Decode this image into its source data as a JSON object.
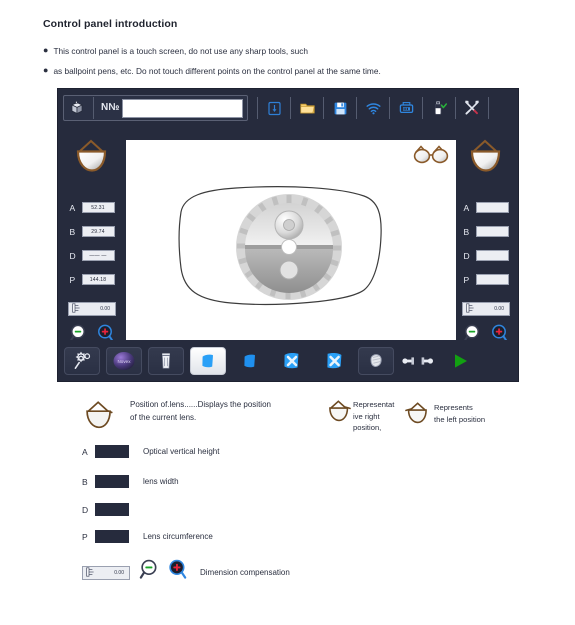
{
  "document": {
    "title": "Control panel introduction",
    "bullets": [
      "This control panel is a touch screen, do not use any sharp tools, such",
      "as ballpoint pens, etc. Do not touch different points on the control panel at the same time."
    ]
  },
  "panel": {
    "top_toolbar": {
      "job_icon": "box-icon",
      "number_label": "N№",
      "number_value": "",
      "number_placeholder": "",
      "buttons": [
        {
          "name": "download-icon",
          "label": ""
        },
        {
          "name": "open-folder-icon",
          "label": ""
        },
        {
          "name": "save-disk-icon",
          "label": ""
        },
        {
          "name": "wifi-icon",
          "label": ""
        },
        {
          "name": "printer-icon",
          "label": ""
        },
        {
          "name": "calibration-bottle-icon",
          "label": ""
        },
        {
          "name": "tools-icon",
          "label": ""
        }
      ]
    },
    "left_side": {
      "eye_icon": "right-lens-icon",
      "values": [
        {
          "label": "A",
          "value": "52.31"
        },
        {
          "label": "B",
          "value": "29.74"
        },
        {
          "label": "D",
          "value": "—— —"
        },
        {
          "label": "P",
          "value": "144.18"
        }
      ],
      "compensation": "0.00",
      "zoom_out_icon": "magnifier-minus-icon",
      "zoom_in_icon": "magnifier-plus-icon"
    },
    "right_side": {
      "eye_icon": "left-lens-icon",
      "values": [
        {
          "label": "A",
          "value": ""
        },
        {
          "label": "B",
          "value": ""
        },
        {
          "label": "D",
          "value": ""
        },
        {
          "label": "P",
          "value": ""
        }
      ],
      "compensation": "0.00",
      "zoom_out_icon": "magnifier-minus-icon",
      "zoom_in_icon": "magnifier-plus-icon"
    },
    "canvas": {
      "glasses_badge_icon": "eyeglasses-icon",
      "lens_outline": "lens-shape-outline",
      "tracer_wheel": "grinding-wheel-icon"
    },
    "bottom_toolbar": {
      "buttons": [
        {
          "name": "settings-gear-icon",
          "active": false
        },
        {
          "name": "logo-sphere-icon",
          "active": false
        },
        {
          "name": "trash-icon",
          "active": false
        },
        {
          "name": "shape-select-icon",
          "active": true
        },
        {
          "name": "shape-blue-icon",
          "active": false
        },
        {
          "name": "shape-delete-left-icon",
          "active": false
        },
        {
          "name": "shape-delete-right-icon",
          "active": false
        },
        {
          "name": "polish-icon",
          "active": false
        },
        {
          "name": "drill-bits-icon",
          "active": false
        },
        {
          "name": "start-play-icon",
          "active": false
        }
      ]
    }
  },
  "legend": {
    "position_lens": {
      "icon": "right-lens-icon",
      "line1": "Position of.lens......Displays the position",
      "line2": "of the current lens."
    },
    "right_position": {
      "icon": "glasses-right-icon",
      "line1": "Representat",
      "line2": "ive right",
      "line3": "position,"
    },
    "left_position": {
      "icon": "glasses-left-icon",
      "line1": "Represents",
      "line2": "the left position"
    },
    "measurements": [
      {
        "label": "A",
        "desc": "Optical vertical height"
      },
      {
        "label": "B",
        "desc": "lens width"
      },
      {
        "label": "D",
        "desc": ""
      },
      {
        "label": "P",
        "desc": "Lens circumference"
      }
    ],
    "compensation_row": {
      "value": "0.00",
      "minus_icon": "magnifier-minus-icon",
      "plus_icon": "magnifier-plus-icon",
      "desc": "Dimension compensation"
    }
  },
  "colors": {
    "panel_bg": "#262b3d",
    "accent_blue": "#2196f3",
    "folder_yellow": "#f2c14e",
    "green": "#15a014",
    "red": "#e8243c"
  }
}
